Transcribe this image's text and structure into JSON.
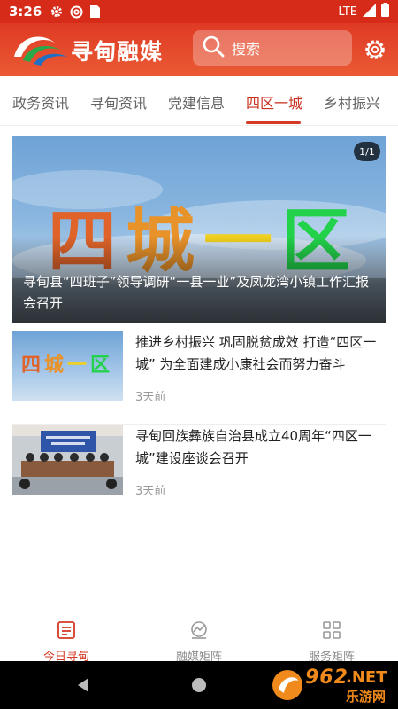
{
  "status_bar": {
    "time": "3:26",
    "network": "LTE",
    "icons": [
      "gear-icon",
      "at-icon",
      "sim-icon",
      "signal-icon",
      "battery-icon"
    ]
  },
  "header": {
    "app_name": "寻甸融媒",
    "search_placeholder": "搜索",
    "brand_color": "#e0452c"
  },
  "tabs": [
    {
      "label": "政务资讯",
      "active": false
    },
    {
      "label": "寻甸资讯",
      "active": false
    },
    {
      "label": "党建信息",
      "active": false
    },
    {
      "label": "四区一城",
      "active": true
    },
    {
      "label": "乡村振兴",
      "active": false
    }
  ],
  "hero": {
    "badge": "1/1",
    "image_text": "四城一区",
    "caption": "寻甸县“四班子”领导调研“一县一业”及凤龙湾小镇工作汇报会召开"
  },
  "articles": [
    {
      "title": "推进乡村振兴 巩固脱贫成效 打造“四区一城” 为全面建成小康社会而努力奋斗",
      "time": "3天前",
      "thumb_text": "四城一区"
    },
    {
      "title": "寻甸回族彝族自治县成立40周年“四区一城”建设座谈会召开",
      "time": "3天前",
      "thumb_text": ""
    }
  ],
  "bottom_nav": [
    {
      "label": "今日寻甸",
      "icon": "news-icon",
      "active": true
    },
    {
      "label": "融媒矩阵",
      "icon": "media-matrix-icon",
      "active": false
    },
    {
      "label": "服务矩阵",
      "icon": "service-grid-icon",
      "active": false
    }
  ],
  "watermark": {
    "brand": "962",
    "tld": ".NET",
    "name": "乐游网"
  }
}
